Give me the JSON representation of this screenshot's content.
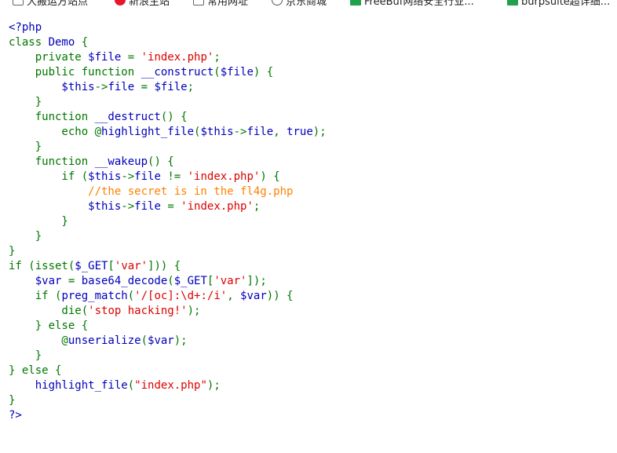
{
  "bookmarks": [
    {
      "icon": "doc-icon",
      "label": "大搬运方站点"
    },
    {
      "icon": "weibo-icon",
      "label": "新浪主站"
    },
    {
      "icon": "doc-icon",
      "label": "常用网址"
    },
    {
      "icon": "globe-icon",
      "label": "京东商城"
    },
    {
      "icon": "green-icon",
      "label": "FreeBuf网络安全行业..."
    },
    {
      "icon": "green-icon",
      "label": "burpsuite超详细..."
    }
  ],
  "colors": {
    "default": "#0000BB",
    "keyword": "#007700",
    "string": "#DD0000",
    "comment": "#FF8000",
    "html": "#000000"
  },
  "code_lines": [
    [
      [
        "default",
        "<?php"
      ]
    ],
    [
      [
        "keyword",
        "class "
      ],
      [
        "default",
        "Demo "
      ],
      [
        "keyword",
        "{"
      ]
    ],
    [
      [
        "keyword",
        "    private "
      ],
      [
        "default",
        "$file "
      ],
      [
        "keyword",
        "= "
      ],
      [
        "string",
        "'index.php'"
      ],
      [
        "keyword",
        ";"
      ]
    ],
    [
      [
        "keyword",
        "    public function "
      ],
      [
        "default",
        "__construct"
      ],
      [
        "keyword",
        "("
      ],
      [
        "default",
        "$file"
      ],
      [
        "keyword",
        ") {"
      ]
    ],
    [
      [
        "default",
        "        $this"
      ],
      [
        "keyword",
        "->"
      ],
      [
        "default",
        "file "
      ],
      [
        "keyword",
        "= "
      ],
      [
        "default",
        "$file"
      ],
      [
        "keyword",
        ";"
      ]
    ],
    [
      [
        "keyword",
        "    }"
      ]
    ],
    [
      [
        "keyword",
        "    function "
      ],
      [
        "default",
        "__destruct"
      ],
      [
        "keyword",
        "() {"
      ]
    ],
    [
      [
        "keyword",
        "        echo @"
      ],
      [
        "default",
        "highlight_file"
      ],
      [
        "keyword",
        "("
      ],
      [
        "default",
        "$this"
      ],
      [
        "keyword",
        "->"
      ],
      [
        "default",
        "file"
      ],
      [
        "keyword",
        ", "
      ],
      [
        "default",
        "true"
      ],
      [
        "keyword",
        ");"
      ]
    ],
    [
      [
        "keyword",
        "    }"
      ]
    ],
    [
      [
        "keyword",
        "    function "
      ],
      [
        "default",
        "__wakeup"
      ],
      [
        "keyword",
        "() {"
      ]
    ],
    [
      [
        "keyword",
        "        if ("
      ],
      [
        "default",
        "$this"
      ],
      [
        "keyword",
        "->"
      ],
      [
        "default",
        "file "
      ],
      [
        "keyword",
        "!= "
      ],
      [
        "string",
        "'index.php'"
      ],
      [
        "keyword",
        ") {"
      ]
    ],
    [
      [
        "comment",
        "            //the secret is in the fl4g.php"
      ]
    ],
    [
      [
        "default",
        "            $this"
      ],
      [
        "keyword",
        "->"
      ],
      [
        "default",
        "file "
      ],
      [
        "keyword",
        "= "
      ],
      [
        "string",
        "'index.php'"
      ],
      [
        "keyword",
        ";"
      ]
    ],
    [
      [
        "keyword",
        "        }"
      ]
    ],
    [
      [
        "keyword",
        "    }"
      ]
    ],
    [
      [
        "keyword",
        "}"
      ]
    ],
    [
      [
        "keyword",
        "if (isset("
      ],
      [
        "default",
        "$_GET"
      ],
      [
        "keyword",
        "["
      ],
      [
        "string",
        "'var'"
      ],
      [
        "keyword",
        "])) {"
      ]
    ],
    [
      [
        "default",
        "    $var "
      ],
      [
        "keyword",
        "= "
      ],
      [
        "default",
        "base64_decode"
      ],
      [
        "keyword",
        "("
      ],
      [
        "default",
        "$_GET"
      ],
      [
        "keyword",
        "["
      ],
      [
        "string",
        "'var'"
      ],
      [
        "keyword",
        "]);"
      ]
    ],
    [
      [
        "keyword",
        "    if ("
      ],
      [
        "default",
        "preg_match"
      ],
      [
        "keyword",
        "("
      ],
      [
        "string",
        "'/[oc]:\\d+:/i'"
      ],
      [
        "keyword",
        ", "
      ],
      [
        "default",
        "$var"
      ],
      [
        "keyword",
        ")) {"
      ]
    ],
    [
      [
        "keyword",
        "        die("
      ],
      [
        "string",
        "'stop hacking!'"
      ],
      [
        "keyword",
        ");"
      ]
    ],
    [
      [
        "keyword",
        "    } else {"
      ]
    ],
    [
      [
        "keyword",
        "        @"
      ],
      [
        "default",
        "unserialize"
      ],
      [
        "keyword",
        "("
      ],
      [
        "default",
        "$var"
      ],
      [
        "keyword",
        ");"
      ]
    ],
    [
      [
        "keyword",
        "    }"
      ]
    ],
    [
      [
        "keyword",
        "} else {"
      ]
    ],
    [
      [
        "keyword",
        "    "
      ],
      [
        "default",
        "highlight_file"
      ],
      [
        "keyword",
        "("
      ],
      [
        "string",
        "\"index.php\""
      ],
      [
        "keyword",
        ");"
      ]
    ],
    [
      [
        "keyword",
        "}"
      ]
    ],
    [
      [
        "default",
        "?>"
      ]
    ]
  ]
}
